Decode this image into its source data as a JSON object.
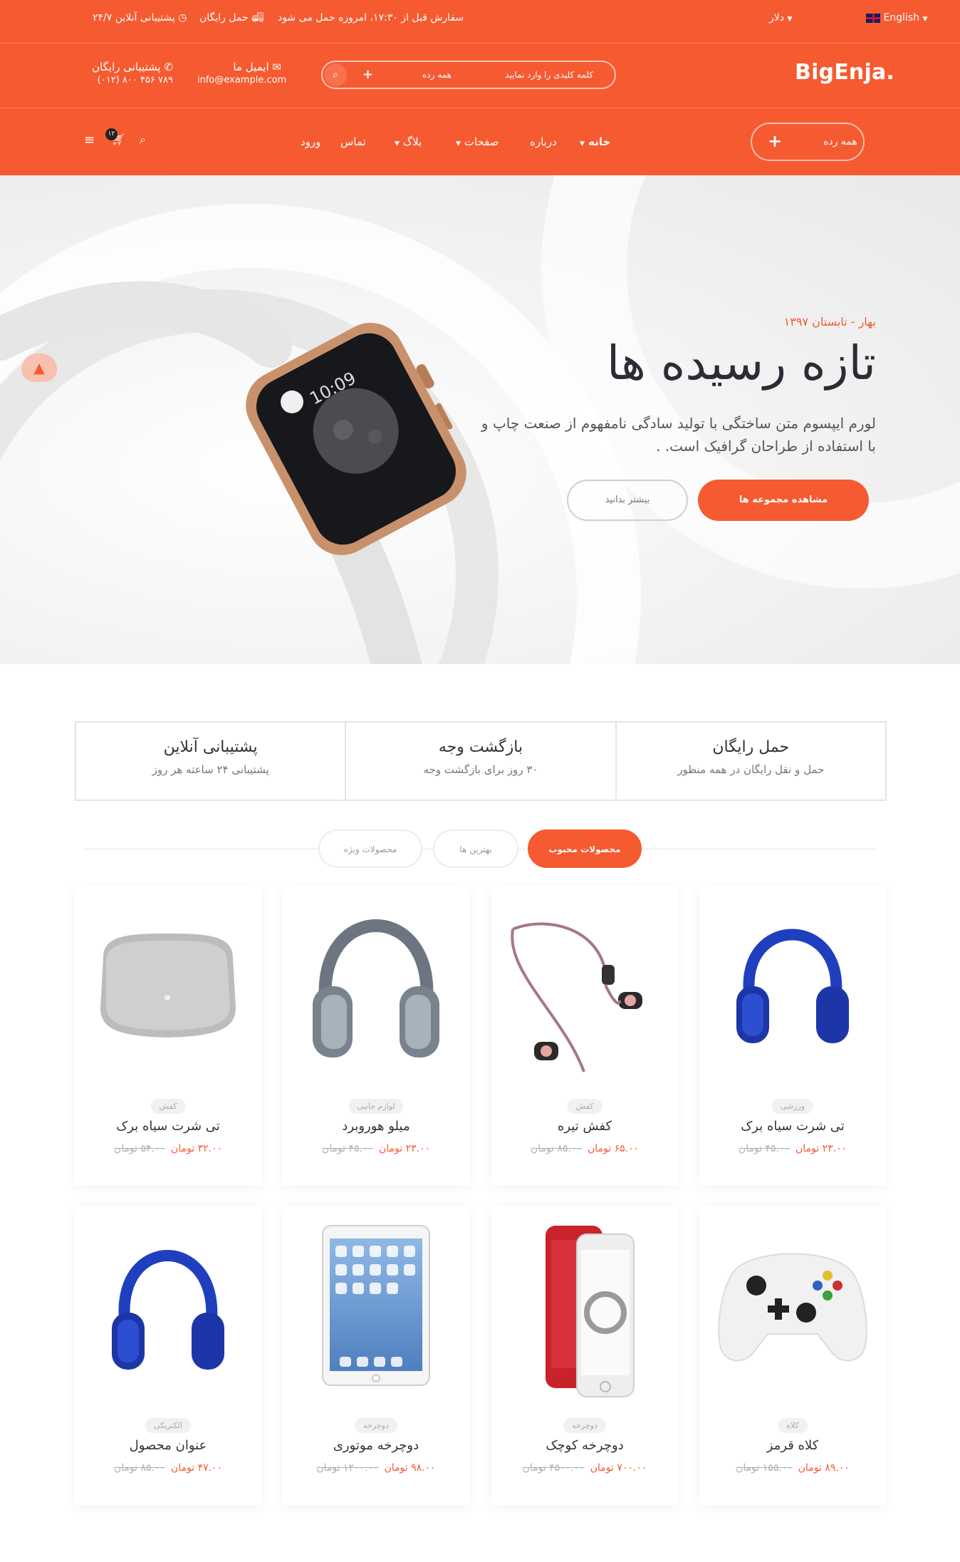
{
  "topbar": {
    "language": "English",
    "currency": "دلار",
    "order_note": "سفارش قبل از ۱۷:۳۰، امروزه حمل می شود",
    "free_shipping": "حمل رایگان",
    "support": "۲۴/۷ پشتیبانی آنلاین"
  },
  "header": {
    "logo": "BigEnja.",
    "search_placeholder": "کلمه کلیدی را وارد نمایید",
    "search_category": "همه رده",
    "email_title": "ایمیل ما",
    "email_value": "info@example.com",
    "phone_title": "پشتیبانی رایگان",
    "phone_value": "(۰۱۲) ۸۰۰ ۴۵۶ ۷۸۹"
  },
  "nav": {
    "all_categories": "همه رده",
    "items": [
      "خانه",
      "درباره",
      "صفحات",
      "بلاگ",
      "تماس",
      "ورود"
    ],
    "cart_count": "۱۲"
  },
  "hero": {
    "subtitle": "بهار - تابستان ۱۳۹۷",
    "title": "تازه رسیده ها",
    "text": "لورم ایپسوم متن ساختگی با تولید سادگی نامفهوم از صنعت چاپ و با استفاده از طراحان گرافیک است. .",
    "primary_button": "مشاهده مجموعه ها",
    "secondary_button": "بیشتر بدانید"
  },
  "features": [
    {
      "title": "حمل رایگان",
      "desc": "حمل و نقل رایگان در همه منظور"
    },
    {
      "title": "بازگشت وجه",
      "desc": "۳۰ روز برای بازگشت وجه"
    },
    {
      "title": "پشتیبانی آنلاین",
      "desc": "پشتیبانی ۲۴ ساعته هر روز"
    }
  ],
  "tabs": [
    "محصولات محبوب",
    "بهترین ها",
    "محصولات ویژه"
  ],
  "products": [
    {
      "tag": "ورزشی",
      "name": "تی شرت سیاه برک",
      "price": "۲۳.۰۰ تومان",
      "old_price": "۴۵.۰۰ تومان",
      "image": "blue-headphones-icon"
    },
    {
      "tag": "کفش",
      "name": "کفش تیره",
      "price": "۶۵.۰۰ تومان",
      "old_price": "۸۵.۰۰ تومان",
      "image": "earphones-icon"
    },
    {
      "tag": "لوازم جانبی",
      "name": "میلو هوروبرد",
      "price": "۲۳.۰۰ تومان",
      "old_price": "۴۵.۰۰ تومان",
      "image": "grey-headphones-icon"
    },
    {
      "tag": "کفش",
      "name": "تی شرت سیاه برک",
      "price": "۳۲.۰۰ تومان",
      "old_price": "۵۴.۰۰ تومان",
      "image": "speaker-icon"
    },
    {
      "tag": "کلاه",
      "name": "کلاه قرمز",
      "price": "۸۹.۰۰ تومان",
      "old_price": "۱۵۵.۰۰ تومان",
      "image": "gamepad-icon"
    },
    {
      "tag": "دوچرخه",
      "name": "دوچرخه کوچک",
      "price": "۷۰۰.۰۰ تومان",
      "old_price": "۴۵۰۰.۰۰ تومان",
      "image": "red-phone-icon"
    },
    {
      "tag": "دوچرخه",
      "name": "دوچرخه موتوری",
      "price": "۹۸.۰۰ تومان",
      "old_price": "۱۲۰۰.۰۰ تومان",
      "image": "tablet-icon"
    },
    {
      "tag": "الکتریکی",
      "name": "عنوان محصول",
      "price": "۴۷.۰۰ تومان",
      "old_price": "۸۵.۰۰ تومان",
      "image": "blue-headphones-icon"
    }
  ],
  "colors": {
    "accent": "#f55a31",
    "dark": "#2b2d36"
  }
}
